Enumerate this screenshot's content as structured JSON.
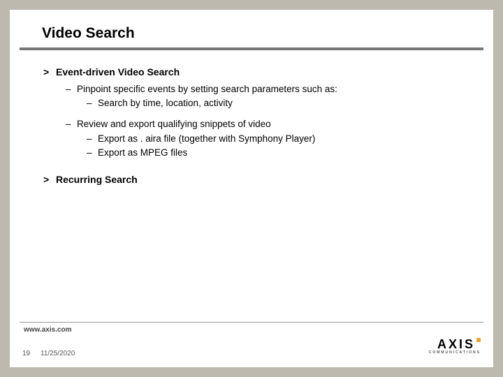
{
  "title": "Video Search",
  "bullets": {
    "l1a": "Event-driven Video Search",
    "l2a": "Pinpoint specific events by setting search parameters such as:",
    "l3a": "Search by time, location, activity",
    "l2b": "Review and export qualifying snippets of video",
    "l3b": "Export as . aira file (together with Symphony Player)",
    "l3c": "Export as MPEG files",
    "l1b": "Recurring Search"
  },
  "marks": {
    "chevron": ">",
    "dash": "–"
  },
  "footer": {
    "url": "www.axis.com",
    "page": "19",
    "date": "11/25/2020"
  },
  "logo": {
    "brand": "AXIS",
    "sub": "COMMUNICATIONS"
  }
}
